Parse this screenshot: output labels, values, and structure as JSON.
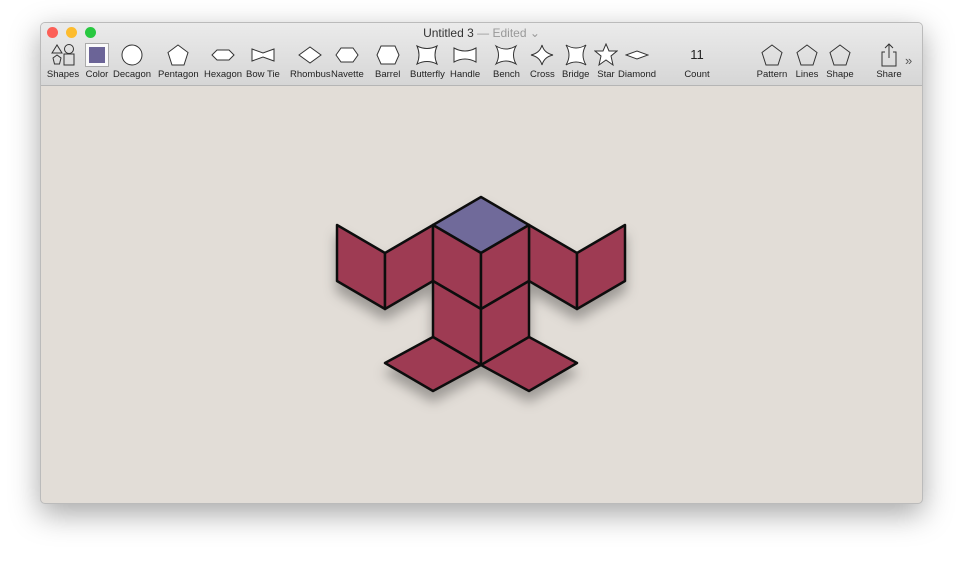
{
  "window": {
    "title": "Untitled 3",
    "status": "— Edited ⌄"
  },
  "toolbar": {
    "shapes": "Shapes",
    "color": "Color",
    "color_value": "#6b6497",
    "items": [
      "Decagon",
      "Pentagon",
      "Hexagon",
      "Bow Tie",
      "Rhombus",
      "Navette",
      "Barrel",
      "Butterfly",
      "Handle",
      "Bench",
      "Cross",
      "Bridge",
      "Star",
      "Diamond"
    ],
    "count_value": "11",
    "count": "Count",
    "pattern": "Pattern",
    "lines": "Lines",
    "shape": "Shape",
    "share": "Share",
    "more": "»"
  },
  "figure": {
    "fill": "#9e3a52",
    "top_fill": "#6f6a9a",
    "stroke": "#111111",
    "piece_count": 11
  }
}
